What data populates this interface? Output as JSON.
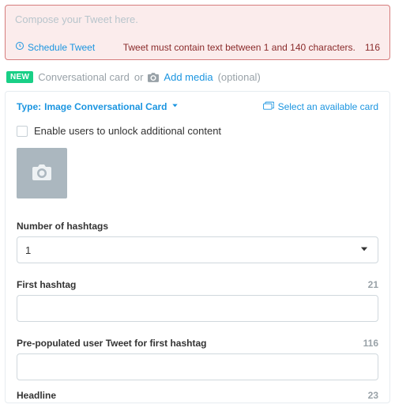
{
  "compose": {
    "placeholder": "Compose your Tweet here.",
    "schedule_label": "Schedule Tweet",
    "error_message": "Tweet must contain text between 1 and 140 characters.",
    "char_count": "116"
  },
  "new_row": {
    "badge": "NEW",
    "label": "Conversational card",
    "or": " or ",
    "add_media": "Add media",
    "optional": " (optional)"
  },
  "card": {
    "type_prefix": "Type: ",
    "type_value": "Image Conversational Card",
    "select_available": "Select an available card",
    "enable_unlock": "Enable users to unlock additional content",
    "fields": {
      "num_hashtags": {
        "label": "Number of hashtags",
        "value": "1"
      },
      "first_hashtag": {
        "label": "First hashtag",
        "count": "21",
        "value": ""
      },
      "prepop": {
        "label": "Pre-populated user Tweet for first hashtag",
        "count": "116",
        "value": ""
      },
      "headline": {
        "label": "Headline",
        "count": "23"
      }
    }
  }
}
